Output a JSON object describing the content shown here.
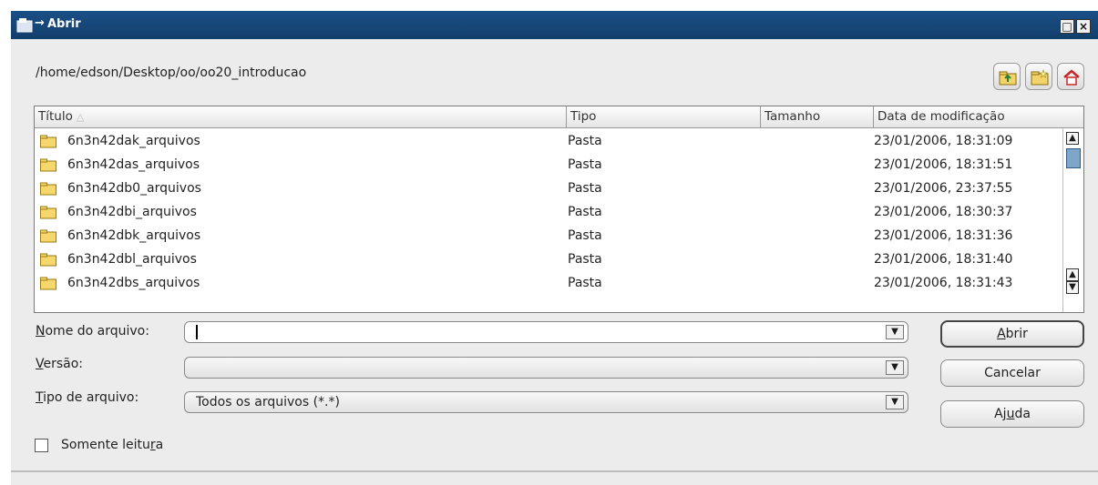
{
  "window": {
    "title": "Abrir",
    "title_prefix": "→"
  },
  "path": "/home/edson/Desktop/oo/oo20_introducao",
  "toolbar_icons": [
    "folder-up-icon",
    "new-folder-icon",
    "home-icon"
  ],
  "columns": [
    "Título",
    "Tipo",
    "Tamanho",
    "Data de modificação"
  ],
  "files": [
    {
      "name": "6n3n42dak_arquivos",
      "type": "Pasta",
      "size": "",
      "date": "23/01/2006, 18:31:09"
    },
    {
      "name": "6n3n42das_arquivos",
      "type": "Pasta",
      "size": "",
      "date": "23/01/2006, 18:31:51"
    },
    {
      "name": "6n3n42db0_arquivos",
      "type": "Pasta",
      "size": "",
      "date": "23/01/2006, 23:37:55"
    },
    {
      "name": "6n3n42dbi_arquivos",
      "type": "Pasta",
      "size": "",
      "date": "23/01/2006, 18:30:37"
    },
    {
      "name": "6n3n42dbk_arquivos",
      "type": "Pasta",
      "size": "",
      "date": "23/01/2006, 18:31:36"
    },
    {
      "name": "6n3n42dbl_arquivos",
      "type": "Pasta",
      "size": "",
      "date": "23/01/2006, 18:31:40"
    },
    {
      "name": "6n3n42dbs_arquivos",
      "type": "Pasta",
      "size": "",
      "date": "23/01/2006, 18:31:43"
    }
  ],
  "form": {
    "filename_label_first": "N",
    "filename_label_rest": "ome do arquivo:",
    "filename_value": "",
    "version_label_first": "V",
    "version_label_rest": "ersão:",
    "version_value": "",
    "filetype_label_first": "T",
    "filetype_label_rest": "ipo de arquivo:",
    "filetype_value": "Todos os arquivos (*.*)"
  },
  "buttons": {
    "open_first": "A",
    "open_rest": "brir",
    "cancel": "Cancelar",
    "help_a": "Aj",
    "help_u": "u",
    "help_b": "da"
  },
  "readonly": {
    "label_a": "Somente leitu",
    "label_u": "r",
    "label_b": "a",
    "checked": false
  },
  "colors": {
    "titlebar": "#123e6c",
    "dialog_bg": "#ececec",
    "folder": "#f5d76e"
  }
}
